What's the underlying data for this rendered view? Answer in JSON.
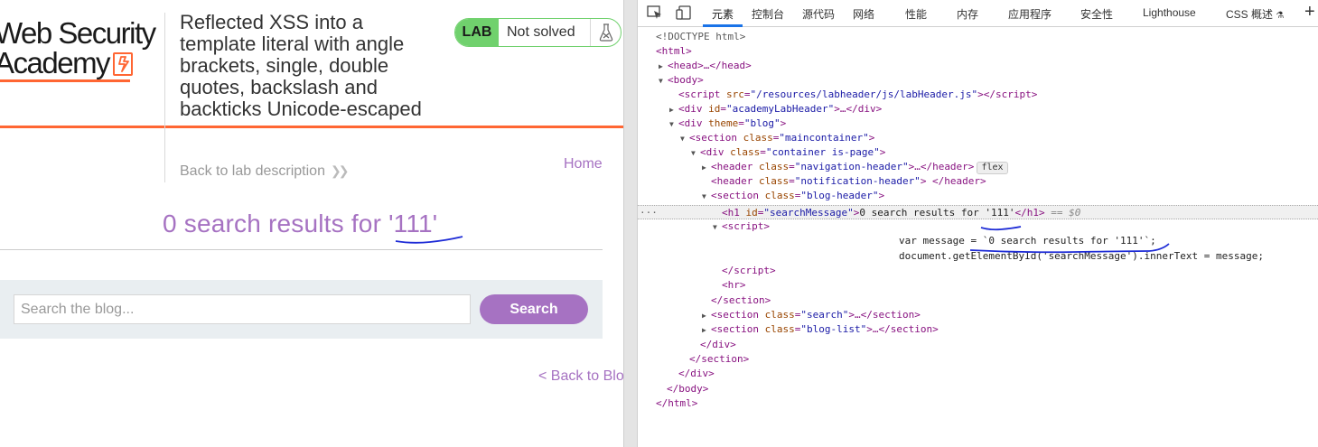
{
  "lab_page": {
    "logo_line1": "Web Security",
    "logo_line2": "Academy",
    "lab_title": "Reflected XSS into a template literal with angle brackets, single, double quotes, backslash and backticks Unicode-escaped",
    "back_to_description": "Back to lab description",
    "badge_label": "LAB",
    "badge_status": "Not solved",
    "home_link": "Home",
    "search_message": "0 search results for '111'",
    "search_placeholder": "Search the blog...",
    "search_button": "Search",
    "back_to_blog": "< Back to Blog"
  },
  "devtools": {
    "tabs": [
      "元素",
      "控制台",
      "源代码",
      "网络",
      "性能",
      "内存",
      "应用程序",
      "安全性",
      "Lighthouse",
      "CSS 概述"
    ],
    "active_tab": "元素",
    "dom": {
      "doctype": "<!DOCTYPE html>",
      "html_open": "<html>",
      "head": "<head>…</head>",
      "body_open": "<body>",
      "script_src_attr": "src",
      "script_src_val": "\"/resources/labheader/js/labHeader.js\"",
      "academy_header_attr": "id",
      "academy_header_val": "\"academyLabHeader\"",
      "theme_attr": "theme",
      "theme_val": "\"blog\"",
      "maincontainer_val": "\"maincontainer\"",
      "container_val": "\"container is-page\"",
      "nav_header_val": "\"navigation-header\"",
      "flex_badge": "flex",
      "notif_header_val": "\"notification-header\"",
      "blog_header_val": "\"blog-header\"",
      "h1_id_val": "\"searchMessage\"",
      "h1_text": "0 search results for '111'",
      "selected_marker": "== $0",
      "script_line1": "var message = `0 search results for '111'`;",
      "script_line2": "document.getElementById('searchMessage').innerText = message;",
      "search_section_val": "\"search\"",
      "blog_list_val": "\"blog-list\""
    }
  }
}
